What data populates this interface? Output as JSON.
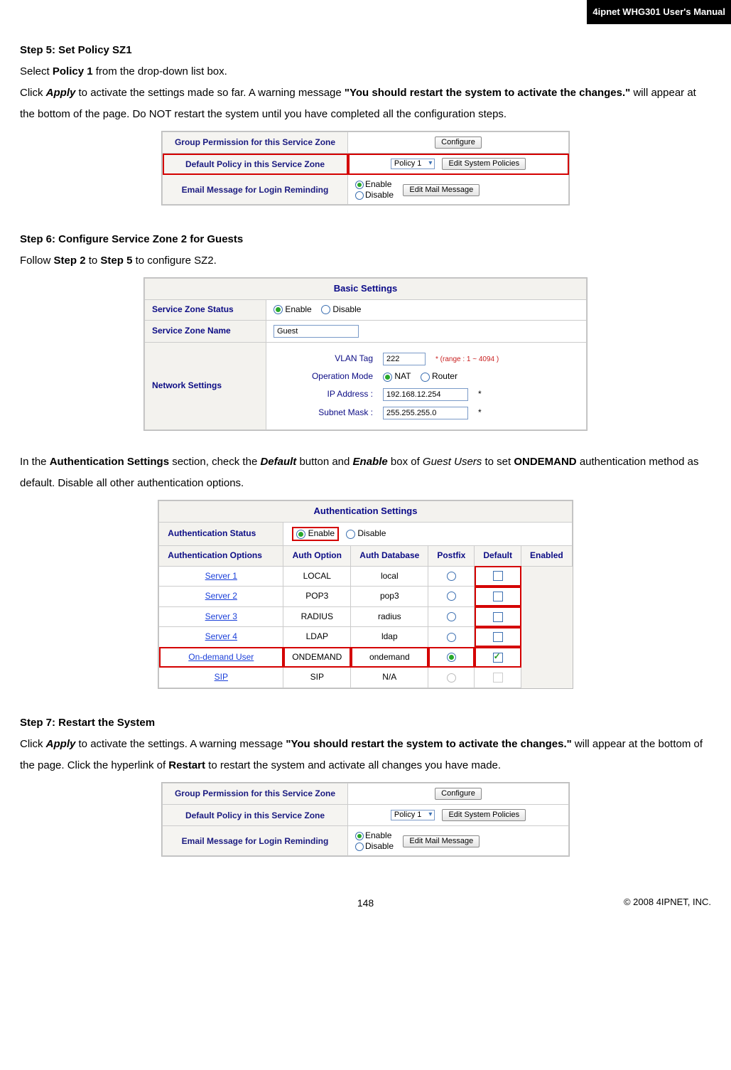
{
  "header": {
    "product_title": "4ipnet WHG301 User's Manual"
  },
  "step5": {
    "heading": "Step 5: Set Policy SZ1",
    "para1_prefix": "Select ",
    "para1_bold": "Policy 1",
    "para1_suffix": " from the drop-down list box.",
    "para2_a": "Click ",
    "para2_apply": "Apply",
    "para2_b": " to activate the settings made so far. A warning message ",
    "para2_warn": "\"You should restart the system to activate the changes.\"",
    "para2_c": " will appear at the bottom of the page. Do NOT restart the system until you have completed all the configuration steps."
  },
  "fig_policy": {
    "row1_label": "Group Permission for this Service Zone",
    "row1_btn": "Configure",
    "row2_label": "Default Policy in this Service Zone",
    "row2_select": "Policy 1",
    "row2_btn": "Edit System Policies",
    "row3_label": "Email Message for Login Reminding",
    "row3_enable": "Enable",
    "row3_disable": "Disable",
    "row3_btn": "Edit Mail Message"
  },
  "step6": {
    "heading": "Step 6: Configure Service Zone 2 for Guests",
    "para1_a": "Follow ",
    "para1_b1": "Step 2",
    "para1_mid": " to ",
    "para1_b2": "Step 5",
    "para1_c": " to configure SZ2."
  },
  "fig_basic": {
    "title": "Basic Settings",
    "status_label": "Service Zone Status",
    "enable": "Enable",
    "disable": "Disable",
    "name_label": "Service Zone Name",
    "name_value": "Guest",
    "net_label": "Network Settings",
    "vlan_label": "VLAN Tag",
    "vlan_value": "222",
    "vlan_range": "* (range : 1 ~ 4094 )",
    "opmode_label": "Operation Mode",
    "nat": "NAT",
    "router": "Router",
    "ip_label": "IP Address :",
    "ip_value": "192.168.12.254",
    "mask_label": "Subnet Mask :",
    "mask_value": "255.255.255.0"
  },
  "step6_para2": {
    "a": "In the ",
    "b1": "Authentication Settings",
    "b": " section, check the ",
    "b2": "Default",
    "c": " button and ",
    "b3": "Enable",
    "d": " box of ",
    "it": "Guest Users",
    "e": " to set ",
    "b4": "ONDEMAND",
    "f": " authentication method as default. Disable all other authentication options."
  },
  "fig_auth": {
    "title": "Authentication Settings",
    "status_label": "Authentication Status",
    "enable": "Enable",
    "disable": "Disable",
    "opts_label": "Authentication Options",
    "h_option": "Auth Option",
    "h_db": "Auth Database",
    "h_postfix": "Postfix",
    "h_default": "Default",
    "h_enabled": "Enabled",
    "rows": [
      {
        "opt": "Server 1",
        "db": "LOCAL",
        "pf": "local",
        "def": false,
        "en": false
      },
      {
        "opt": "Server 2",
        "db": "POP3",
        "pf": "pop3",
        "def": false,
        "en": false
      },
      {
        "opt": "Server 3",
        "db": "RADIUS",
        "pf": "radius",
        "def": false,
        "en": false
      },
      {
        "opt": "Server 4",
        "db": "LDAP",
        "pf": "ldap",
        "def": false,
        "en": false
      },
      {
        "opt": "On-demand User",
        "db": "ONDEMAND",
        "pf": "ondemand",
        "def": true,
        "en": true
      },
      {
        "opt": "SIP",
        "db": "SIP",
        "pf": "N/A",
        "def": "na",
        "en": "na"
      }
    ]
  },
  "step7": {
    "heading": "Step 7: Restart the System",
    "a": "Click ",
    "apply": "Apply",
    "b": " to activate the settings. A warning message ",
    "warn": "\"You should restart the system to activate the changes.\"",
    "c": " will appear at the bottom of the page. Click the hyperlink of ",
    "restart": "Restart",
    "d": " to restart the system and activate all changes you have made."
  },
  "footer": {
    "page": "148",
    "copyright": "© 2008 4IPNET, INC."
  }
}
